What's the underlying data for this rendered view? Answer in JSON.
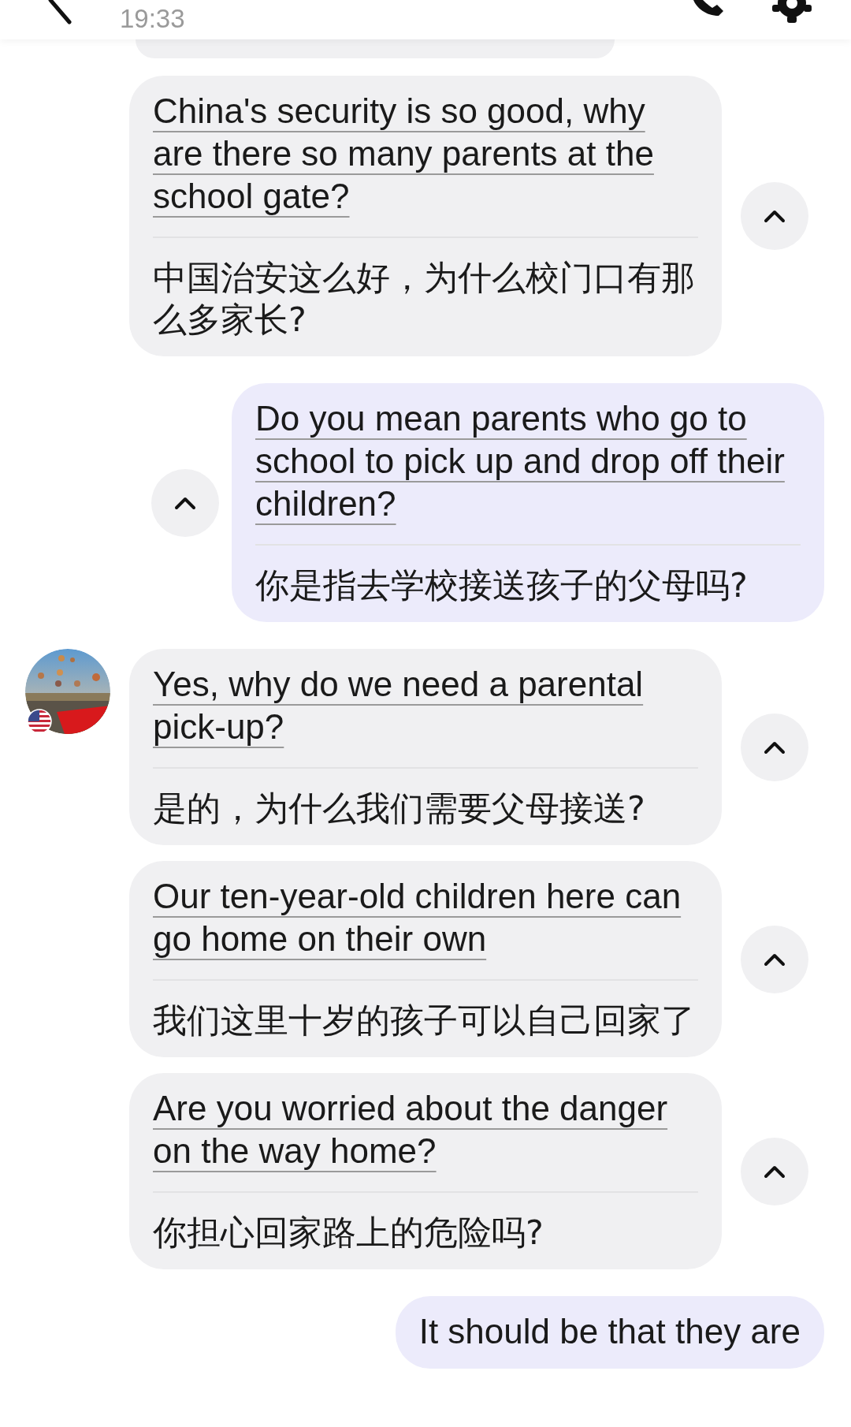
{
  "header": {
    "time": "19:33"
  },
  "messages": [
    {
      "kind": "incoming",
      "avatar": false,
      "underlined": true,
      "text": "China's security is so good, why are there so many parents at the school gate?",
      "translation": "中国治安这么好，为什么校门口有那么多家长?",
      "expanded": true
    },
    {
      "kind": "outgoing",
      "avatar": false,
      "underlined": true,
      "text": "Do you mean parents who go to school to pick up and drop off their children?",
      "translation": "你是指去学校接送孩子的父母吗?",
      "expanded": true
    },
    {
      "kind": "incoming",
      "avatar": true,
      "underlined": true,
      "text": "Yes, why do we need a parental pick-up?",
      "translation": "是的，为什么我们需要父母接送?",
      "expanded": true
    },
    {
      "kind": "incoming",
      "avatar": false,
      "underlined": true,
      "text": "Our ten-year-old children here can go home on their own",
      "translation": "我们这里十岁的孩子可以自己回家了",
      "expanded": true
    },
    {
      "kind": "incoming",
      "avatar": false,
      "underlined": true,
      "text": "Are you worried about the danger on the way home?",
      "translation": "你担心回家路上的危险吗?",
      "expanded": true
    },
    {
      "kind": "outgoing",
      "avatar": false,
      "underlined": false,
      "text": "It should be that they are",
      "expanded": false
    }
  ]
}
